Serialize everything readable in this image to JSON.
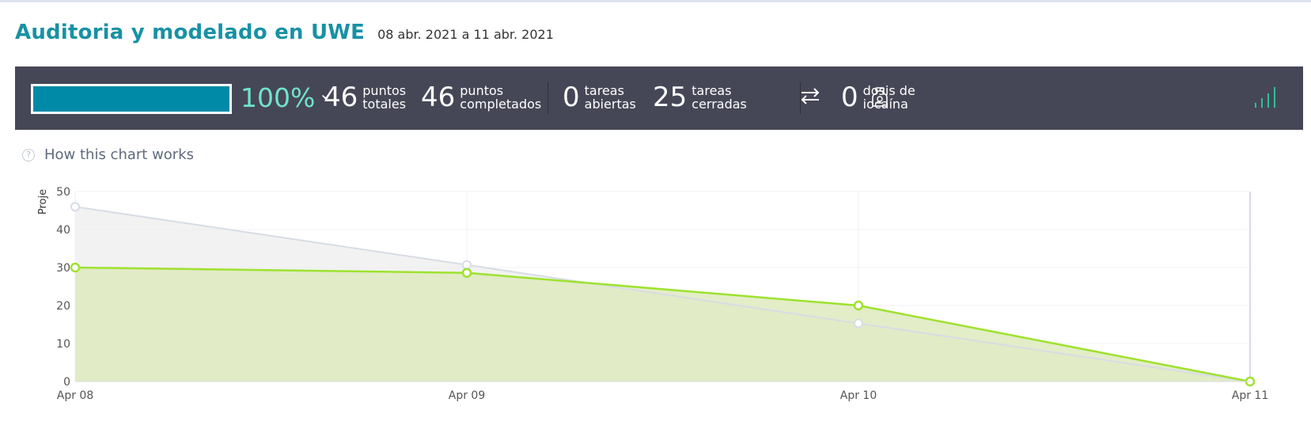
{
  "header": {
    "title": "Auditoria y modelado en UWE",
    "dates": "08 abr. 2021 a 11 abr. 2021"
  },
  "summary": {
    "progress": 1.0,
    "percent": "100%",
    "total_points": {
      "value": "46",
      "line1": "puntos",
      "line2": "totales"
    },
    "completed_points": {
      "value": "46",
      "line1": "puntos",
      "line2": "completados"
    },
    "open_tasks": {
      "value": "0",
      "line1": "tareas",
      "line2": "abiertas"
    },
    "closed_tasks": {
      "value": "25",
      "line1": "tareas",
      "line2": "cerradas"
    },
    "iocaine": {
      "value": "0",
      "line1": "dosis de",
      "line2": "iocaína"
    }
  },
  "help": {
    "label": "How this chart works"
  },
  "colors": {
    "accent": "#1891a5",
    "bar_bg": "#464756",
    "progress": "#008aa8",
    "percent": "#6fe3cf",
    "optimal_line": "#d7dce6",
    "real_line": "#9ee22e",
    "real_fill": "#dce9b9"
  },
  "chart_data": {
    "type": "area",
    "ylabel": "Proje",
    "ylim": [
      0,
      50
    ],
    "yticks": [
      0,
      10,
      20,
      30,
      40,
      50
    ],
    "categories": [
      "Apr 08",
      "Apr 09",
      "Apr 10",
      "Apr 11"
    ],
    "series": [
      {
        "key": "optimal",
        "values": [
          46,
          30.7,
          15.3,
          0
        ]
      },
      {
        "key": "real",
        "values": [
          30,
          28.6,
          20,
          0
        ]
      }
    ]
  }
}
